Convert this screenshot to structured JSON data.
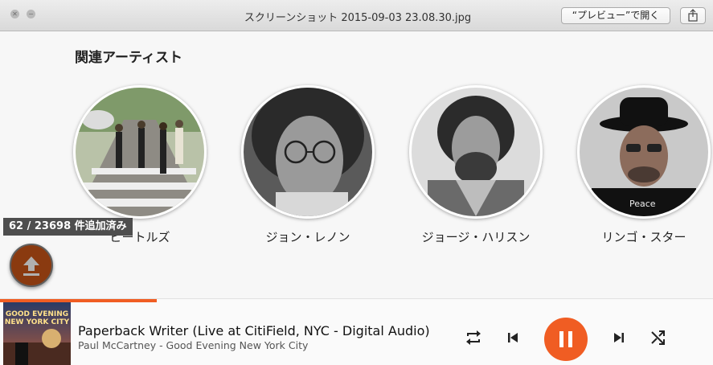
{
  "window": {
    "title": "スクリーンショット 2015-09-03 23.08.30.jpg",
    "open_button": "“プレビュー”で開く"
  },
  "icons": {
    "close": "close-icon",
    "minimize": "minimize-icon",
    "share": "share-icon",
    "upload": "upload-icon",
    "repeat": "repeat-icon",
    "previous": "previous-icon",
    "pause": "pause-icon",
    "next": "next-icon",
    "shuffle": "shuffle-icon"
  },
  "section": {
    "title": "関連アーティスト"
  },
  "artists": [
    {
      "name": "ビートルズ"
    },
    {
      "name": "ジョン・レノン"
    },
    {
      "name": "ジョージ・ハリスン"
    },
    {
      "name": "リンゴ・スター"
    }
  ],
  "toast": {
    "text": "62 / 23698 件追加済み"
  },
  "player": {
    "track_title": "Paperback Writer (Live at CitiField, NYC - Digital Audio)",
    "track_subtitle": "Paul McCartney - Good Evening New York City",
    "album_art_text": "GOOD EVENING NEW YORK CITY",
    "progress_fraction": 0.22
  },
  "colors": {
    "accent": "#f05d23",
    "fab": "#8a3a10"
  }
}
